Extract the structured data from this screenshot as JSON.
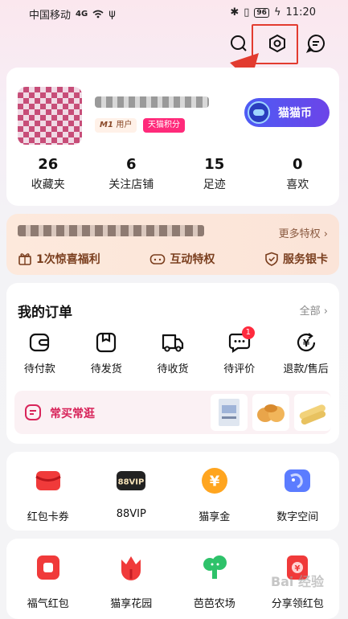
{
  "status_bar": {
    "carrier": "中国移动",
    "signal_label": "4G",
    "battery": "96",
    "time": "11:20"
  },
  "profile": {
    "badge_m1": "M1",
    "badge_m1_suffix": "用户",
    "badge_points": "天猫积分",
    "coin_button": "猫猫币",
    "stats": [
      {
        "value": "26",
        "label": "收藏夹"
      },
      {
        "value": "6",
        "label": "关注店铺"
      },
      {
        "value": "15",
        "label": "足迹"
      },
      {
        "value": "0",
        "label": "喜欢"
      }
    ]
  },
  "vip": {
    "more": "更多特权 ›",
    "perks": [
      {
        "label": "1次惊喜福利",
        "icon": "gift-icon"
      },
      {
        "label": "互动特权",
        "icon": "gamepad-icon"
      },
      {
        "label": "服务银卡",
        "icon": "shield-check-icon"
      }
    ]
  },
  "orders": {
    "title": "我的订单",
    "all": "全部 ›",
    "items": [
      {
        "label": "待付款",
        "icon": "wallet-icon"
      },
      {
        "label": "待发货",
        "icon": "box-icon"
      },
      {
        "label": "待收货",
        "icon": "truck-icon"
      },
      {
        "label": "待评价",
        "icon": "comment-icon",
        "badge": "1"
      },
      {
        "label": "退款/售后",
        "icon": "refund-icon"
      }
    ],
    "frequent_buy": "常买常逛"
  },
  "services": [
    {
      "label": "红包卡券",
      "icon": "red-envelope-card-icon",
      "color": "#f03a3a"
    },
    {
      "label": "88VIP",
      "icon": "88vip-icon",
      "color": "#222222"
    },
    {
      "label": "猫享金",
      "icon": "yen-coin-icon",
      "color": "#ffa51f"
    },
    {
      "label": "数字空间",
      "icon": "digital-space-icon",
      "color": "#5b7cff"
    }
  ],
  "services2": [
    {
      "label": "福气红包",
      "icon": "lucky-envelope-icon",
      "color": "#f03a3a"
    },
    {
      "label": "猫享花园",
      "icon": "tulip-icon",
      "color": "#f03a3a"
    },
    {
      "label": "芭芭农场",
      "icon": "farm-tree-icon",
      "color": "#2ec26a"
    },
    {
      "label": "分享领红包",
      "icon": "share-envelope-icon",
      "color": "#f03a3a"
    }
  ],
  "icons": {
    "search": "search-icon",
    "settings": "settings-icon",
    "message": "message-icon"
  },
  "highlight_color": "#e23b2f",
  "watermark": "Bai 经验"
}
